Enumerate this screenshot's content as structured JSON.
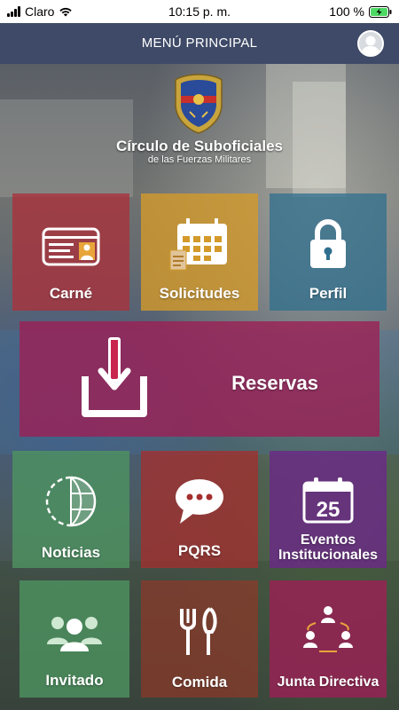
{
  "status_bar": {
    "carrier": "Claro",
    "time": "10:15 p. m.",
    "battery": "100 %"
  },
  "nav": {
    "title": "MENÚ PRINCIPAL"
  },
  "header": {
    "org_name": "Círculo de Suboficiales",
    "org_subtitle": "de las Fuerzas Militares"
  },
  "tiles": {
    "carne": "Carné",
    "solicitudes": "Solicitudes",
    "perfil": "Perfil",
    "reservas": "Reservas",
    "noticias": "Noticias",
    "pqrs": "PQRS",
    "eventos_line1": "Eventos",
    "eventos_line2": "Institucionales",
    "eventos_day": "25",
    "invitado": "Invitado",
    "comida": "Comida",
    "junta": "Junta Directiva"
  },
  "colors": {
    "nav_bar": "#3e4a67",
    "carne": "#a9323c",
    "solicitudes": "#d39a2b",
    "perfil": "#2f6f8d",
    "reservas": "#9c1f55",
    "noticias": "#4e9360",
    "pqrs": "#a52e2e",
    "eventos": "#6a2a86",
    "invitado": "#4e9360",
    "comida": "#8a3a2a",
    "junta": "#9c1f55"
  }
}
